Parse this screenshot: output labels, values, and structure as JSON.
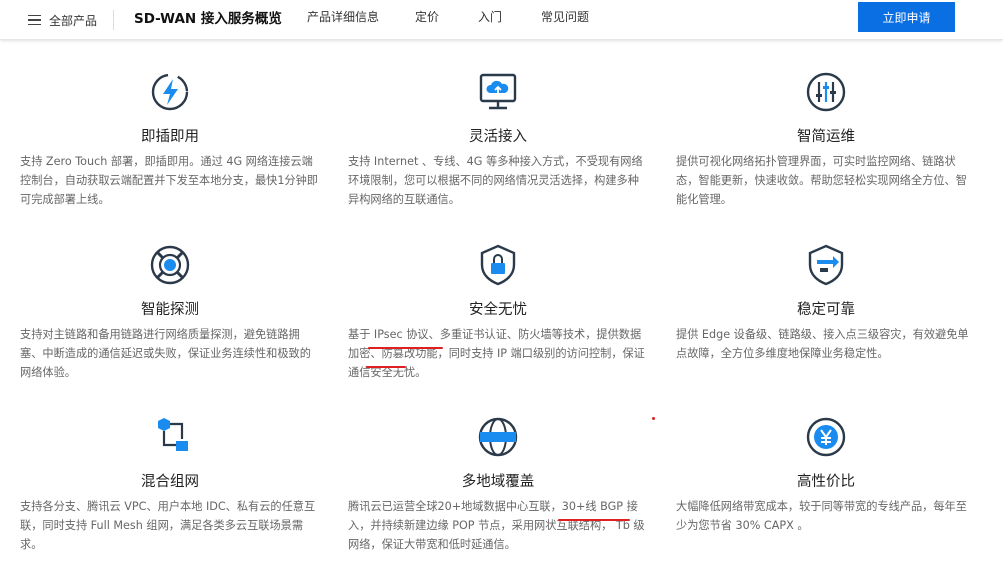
{
  "header": {
    "all_products": "全部产品",
    "title": "SD-WAN 接入服务概览",
    "nav": [
      "产品详细信息",
      "定价",
      "入门",
      "常见问题"
    ],
    "apply_button": "立即申请",
    "accent_color": "#0a6fe3"
  },
  "features": [
    {
      "icon": "lightning-plug-icon",
      "title": "即插即用",
      "desc": "支持 Zero Touch 部署，即插即用。通过 4G 网络连接云端控制台，自动获取云端配置并下发至本地分支，最快1分钟即可完成部署上线。"
    },
    {
      "icon": "cloud-upload-monitor-icon",
      "title": "灵活接入",
      "desc": "支持 Internet 、专线、4G 等多种接入方式，不受现有网络环境限制，您可以根据不同的网络情况灵活选择，构建多种异构网络的互联通信。"
    },
    {
      "icon": "sliders-icon",
      "title": "智简运维",
      "desc": "提供可视化网络拓扑管理界面，可实时监控网络、链路状态，智能更新，快速收敛。帮助您轻松实现网络全方位、智能化管理。"
    },
    {
      "icon": "lifebuoy-icon",
      "title": "智能探测",
      "desc": "支持对主链路和备用链路进行网络质量探测，避免链路拥塞、中断造成的通信延迟或失败，保证业务连续性和极致的网络体验。"
    },
    {
      "icon": "shield-lock-icon",
      "title": "安全无忧",
      "desc": "基于 IPsec 协议、多重证书认证、防火墙等技术，提供数据加密、防篡改功能，同时支持 IP 端口级别的访问控制，保证通信安全无忧。"
    },
    {
      "icon": "shield-exchange-icon",
      "title": "稳定可靠",
      "desc": "提供 Edge 设备级、链路级、接入点三级容灾，有效避免单点故障，全方位多维度地保障业务稳定性。"
    },
    {
      "icon": "hybrid-network-icon",
      "title": "混合组网",
      "desc": "支持各分支、腾讯云 VPC、用户本地 IDC、私有云的任意互联，同时支持 Full Mesh 组网，满足各类多云互联场景需求。"
    },
    {
      "icon": "globe-icon",
      "title": "多地域覆盖",
      "desc": "腾讯云已运营全球20+地域数据中心互联，30+线 BGP 接入，并持续新建边缘 POP 节点，采用网状互联结构， Tb 级网络，保证大带宽和低时延通信。"
    },
    {
      "icon": "yen-coin-icon",
      "title": "高性价比",
      "desc": "大幅降低网络带宽成本，较于同等带宽的专线产品，每年至少为您节省 30% CAPX 。"
    }
  ]
}
